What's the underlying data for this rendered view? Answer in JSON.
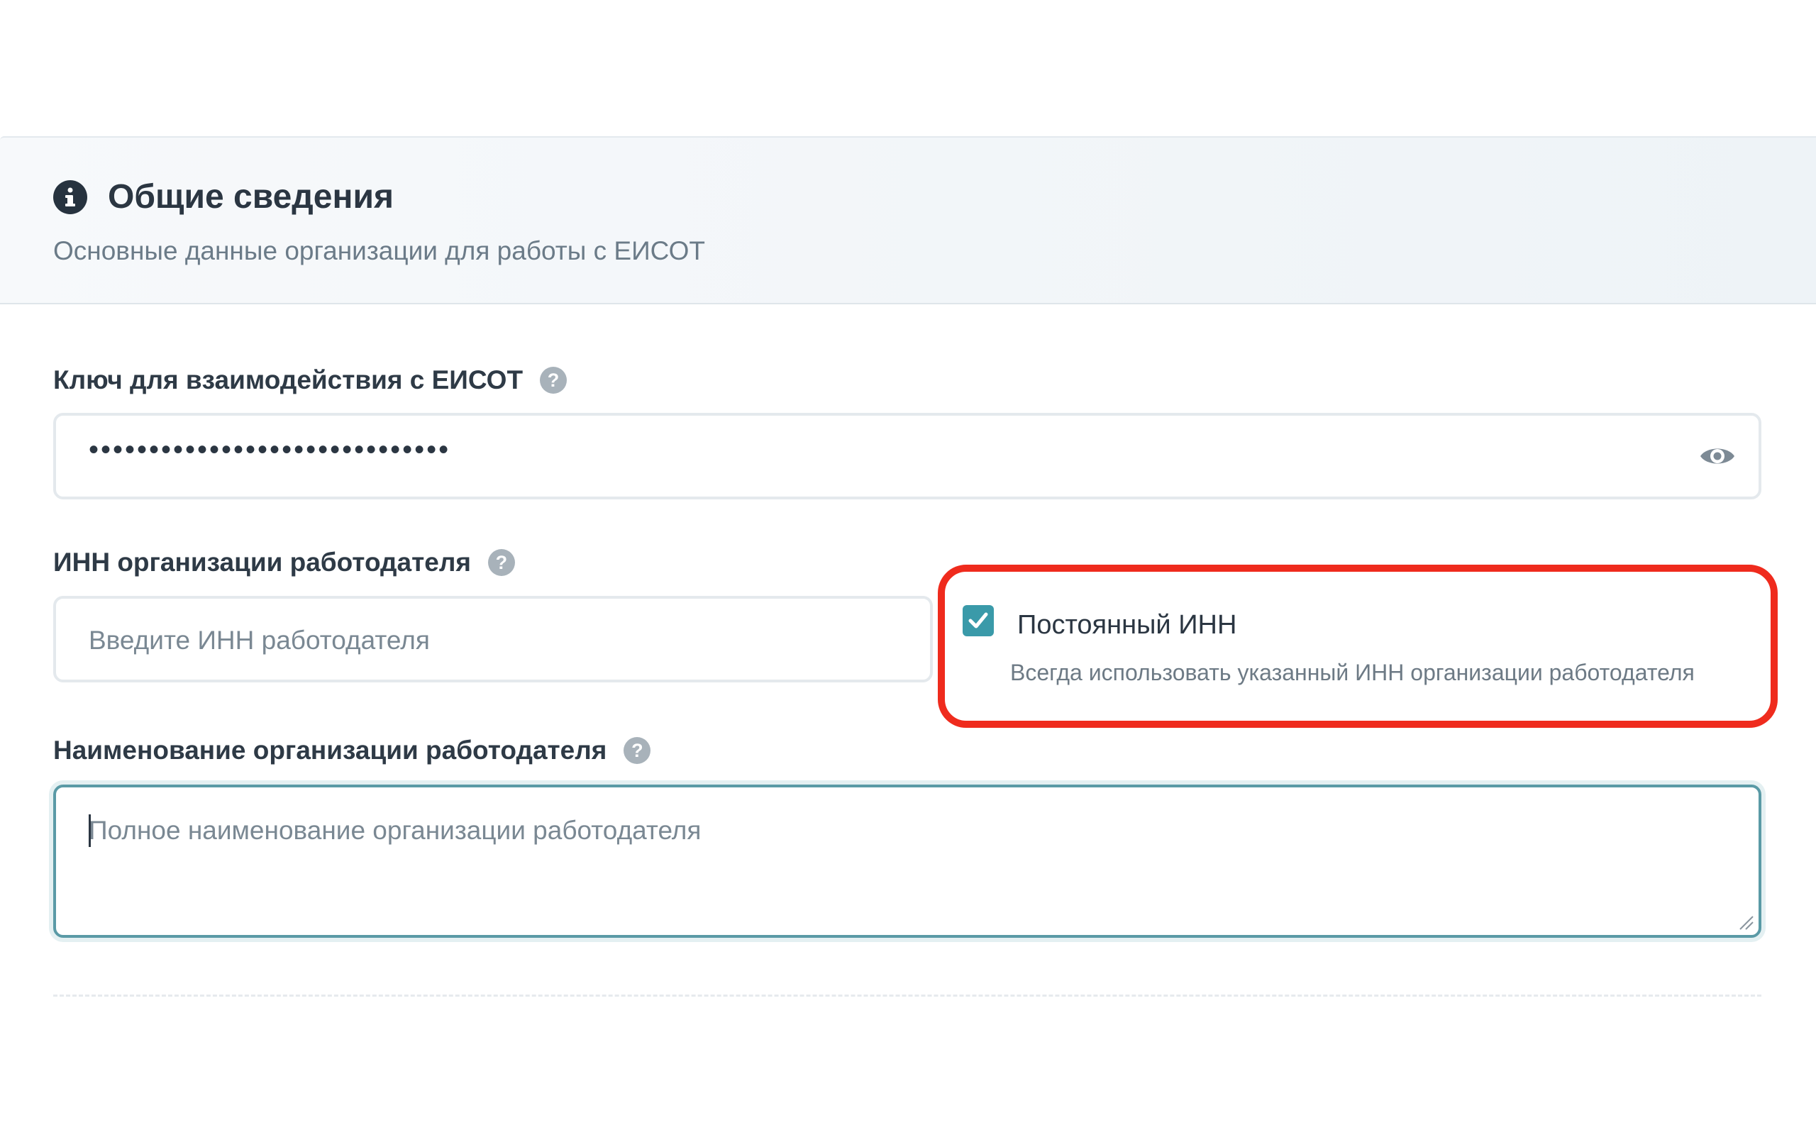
{
  "section": {
    "title": "Общие сведения",
    "subtitle": "Основные данные организации для работы с ЕИСОТ",
    "icon": "info-icon"
  },
  "key_field": {
    "label": "Ключ для взаимодействия с ЕИСОТ",
    "help": "?",
    "value_masked": "••••••••••••••••••••••••••••••",
    "toggle_icon": "eye-icon"
  },
  "inn_field": {
    "label": "ИНН организации работодателя",
    "help": "?",
    "placeholder": "Введите ИНН работодателя",
    "value": ""
  },
  "permanent_inn": {
    "label": "Постоянный ИНН",
    "hint": "Всегда использовать указанный ИНН организации работодателя",
    "checked": true
  },
  "name_field": {
    "label": "Наименование организации работодателя",
    "help": "?",
    "placeholder": "Полное наименование организации работодателя",
    "value": ""
  },
  "colors": {
    "accent": "#3a9aa9",
    "highlight": "#ef2b1d",
    "focus_border": "#5a9aa6"
  }
}
